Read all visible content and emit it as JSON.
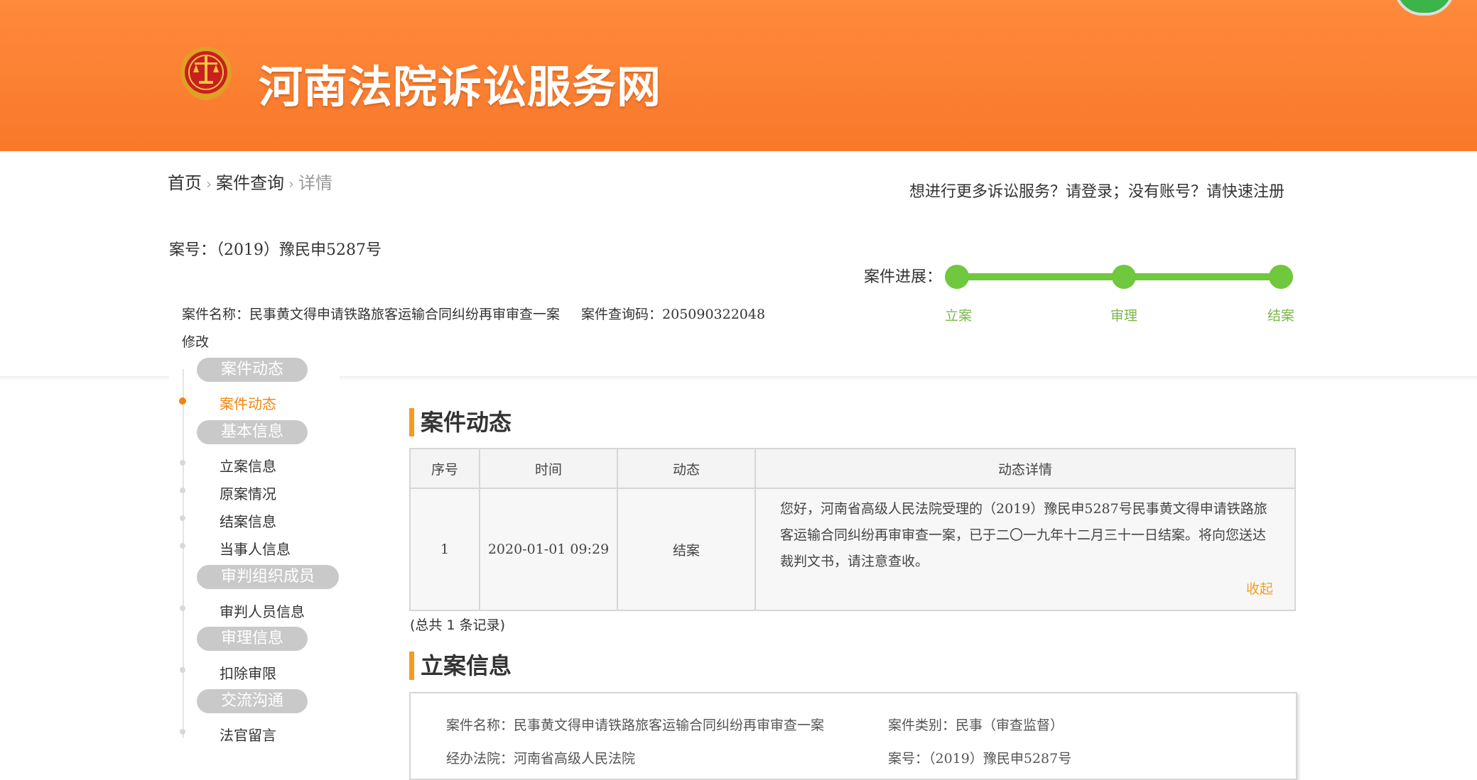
{
  "header": {
    "site_title": "河南法院诉讼服务网",
    "emblem_icon": "court-emblem-icon",
    "brand_color": "#f9782a"
  },
  "breadcrumb": {
    "home": "首页",
    "case_query": "案件查询",
    "detail": "详情"
  },
  "login_tip": "想进行更多诉讼服务？请登录；没有账号？请快速注册",
  "case": {
    "case_no_line": "案号：（2019）豫民申5287号",
    "name_line": "案件名称：民事黄文得申请铁路旅客运输合同纠纷再审审查一案",
    "query_code_line": "案件查询码：205090322048",
    "modify": "修改"
  },
  "progress": {
    "label": "案件进展：",
    "steps": [
      "立案",
      "审理",
      "结案"
    ],
    "completed": 3,
    "color": "#6fc83d"
  },
  "sidebar": {
    "groups": [
      {
        "title": "案件动态",
        "items": [
          "案件动态"
        ]
      },
      {
        "title": "基本信息",
        "items": [
          "立案信息",
          "原案情况",
          "结案信息",
          "当事人信息"
        ]
      },
      {
        "title": "审判组织成员",
        "items": [
          "审判人员信息"
        ]
      },
      {
        "title": "审理信息",
        "items": [
          "扣除审限"
        ]
      },
      {
        "title": "交流沟通",
        "items": [
          "法官留言"
        ]
      }
    ],
    "active_item": "案件动态",
    "accent_color": "#f0860f"
  },
  "dynamics": {
    "title": "案件动态",
    "columns": [
      "序号",
      "时间",
      "动态",
      "动态详情"
    ],
    "rows": [
      {
        "index": "1",
        "time": "2020-01-01 09:29",
        "status": "结案",
        "detail": "您好，河南省高级人民法院受理的（2019）豫民申5287号民事黄文得申请铁路旅客运输合同纠纷再审审查一案，已于二〇一九年十二月三十一日结案。将向您送达裁判文书，请注意查收。",
        "collapse": "收起"
      }
    ],
    "total": "(总共 1 条记录)"
  },
  "filing": {
    "title": "立案信息",
    "case_name": "案件名称：民事黄文得申请铁路旅客运输合同纠纷再审审查一案",
    "case_type": "案件类别：民事（审查监督）",
    "court": "经办法院：河南省高级人民法院",
    "case_no": "案号：（2019）豫民申5287号"
  }
}
